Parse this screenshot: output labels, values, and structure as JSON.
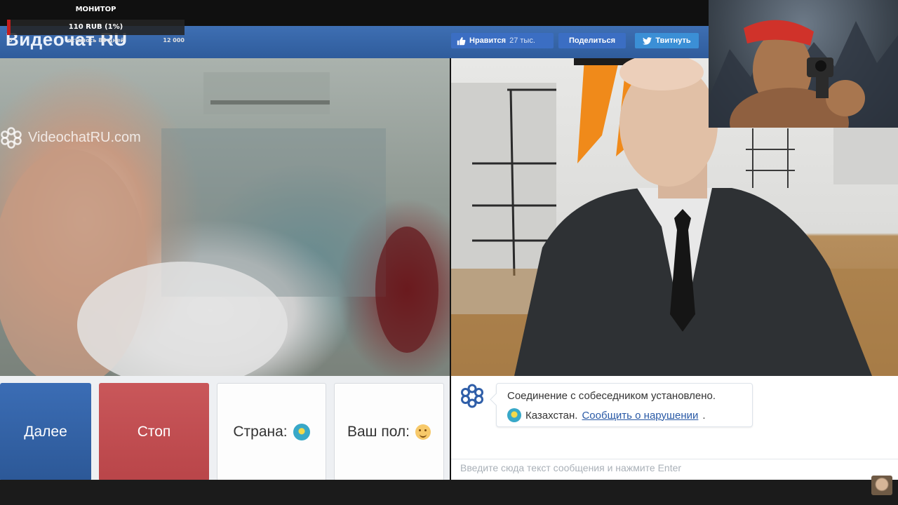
{
  "overlay": {
    "title": "МОНИТОР",
    "amount": "110 RUB (1%)",
    "progress_percent": 1,
    "left_small": "0",
    "remaining": "осталось 88 дней",
    "goal": "12 000"
  },
  "header": {
    "logo": "Видеочат RU",
    "like_label": "Нравится",
    "like_count": "27 тыс.",
    "share_label": "Поделиться",
    "tweet_label": "Твитнуть"
  },
  "video": {
    "watermark": "VideochatRU.com"
  },
  "controls": {
    "next_label": "Далее",
    "stop_label": "Стоп",
    "country_label": "Страна:",
    "gender_label": "Ваш пол:"
  },
  "chat": {
    "message_connected": "Соединение с собеседником установлено.",
    "country_name": "Казахстан.",
    "report_link": "Сообщить о нарушении",
    "report_suffix": ".",
    "input_placeholder": "Введите сюда текст сообщения и нажмите Enter"
  },
  "colors": {
    "header_blue": "#2f5c9c",
    "next_blue": "#2c5897",
    "stop_red": "#b94549",
    "link_blue": "#2a5aa6"
  },
  "icons": [
    "thumbs-up-icon",
    "twitter-bird-icon",
    "videochat-logo-icon",
    "kazakhstan-flag-icon",
    "smiley-icon"
  ]
}
